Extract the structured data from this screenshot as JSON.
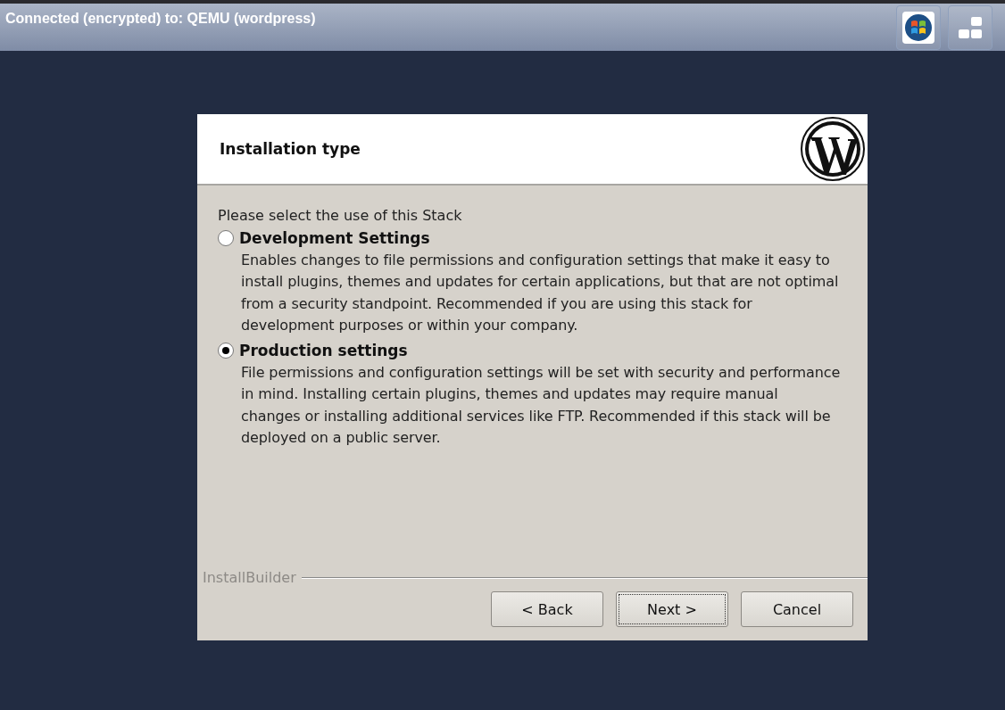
{
  "top_bar": {
    "title": "Connected (encrypted) to: QEMU (wordpress)"
  },
  "dialog": {
    "title": "Installation type",
    "prompt": "Please select the use of this Stack",
    "options": [
      {
        "label": "Development Settings",
        "selected": false,
        "description": "Enables changes to file permissions and configuration settings that make it easy to install plugins, themes and updates for certain applications, but that are not optimal from a security standpoint. Recommended if you are using this stack for development purposes or within your company."
      },
      {
        "label": "Production settings",
        "selected": true,
        "description": "File permissions and configuration settings will be set with security and performance in mind. Installing certain plugins, themes and updates may require manual changes or installing additional services like FTP. Recommended if this stack will be deployed on a public server."
      }
    ],
    "footer_label": "InstallBuilder",
    "buttons": [
      {
        "label": "< Back",
        "focused": false
      },
      {
        "label": "Next >",
        "focused": true
      },
      {
        "label": "Cancel",
        "focused": false
      }
    ]
  }
}
